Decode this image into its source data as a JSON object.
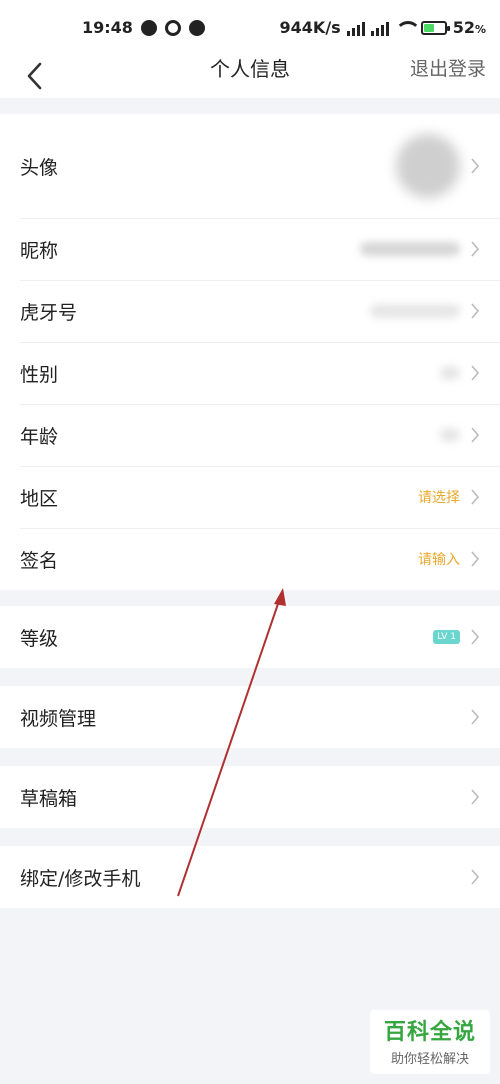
{
  "statusbar": {
    "time": "19:48",
    "net_speed": "944K/s",
    "battery_pct": "52",
    "battery_suffix": "%",
    "battery_level": 0.52
  },
  "navbar": {
    "title": "个人信息",
    "logout_label": "退出登录"
  },
  "profile": {
    "avatar_label": "头像",
    "nickname_label": "昵称",
    "huya_id_label": "虎牙号",
    "gender_label": "性别",
    "age_label": "年龄",
    "region_label": "地区",
    "region_hint": "请选择",
    "signature_label": "签名",
    "signature_hint": "请输入"
  },
  "level": {
    "label": "等级",
    "badge": "LV 1"
  },
  "video": {
    "label": "视频管理"
  },
  "drafts": {
    "label": "草稿箱"
  },
  "phone": {
    "label": "绑定/修改手机"
  },
  "watermark": {
    "title": "百科全说",
    "subtitle": "助你轻松解决"
  },
  "colors": {
    "hint": "#e9a92c",
    "badge": "#6ad6cf",
    "annotation_arrow": "#b03030",
    "watermark": "#35a640"
  },
  "icons": {
    "back": "chevron-left-icon",
    "row_arrow": "chevron-right-icon"
  }
}
